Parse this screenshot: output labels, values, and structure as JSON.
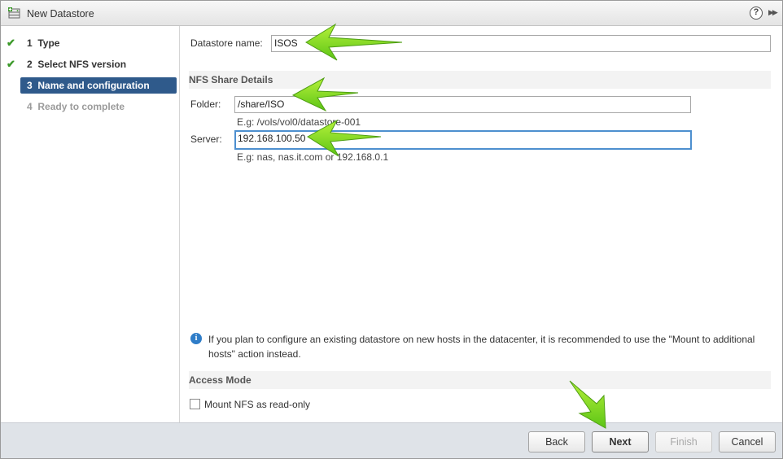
{
  "window": {
    "title": "New Datastore",
    "icon": "datastore-icon"
  },
  "steps": [
    {
      "number": "1",
      "label": "Type",
      "state": "done"
    },
    {
      "number": "2",
      "label": "Select NFS version",
      "state": "done"
    },
    {
      "number": "3",
      "label": "Name and configuration",
      "state": "current"
    },
    {
      "number": "4",
      "label": "Ready to complete",
      "state": "pending"
    }
  ],
  "form": {
    "datastore_name_label": "Datastore name:",
    "datastore_name_value": "ISOS",
    "nfs_section_title": "NFS Share Details",
    "folder_label": "Folder:",
    "folder_value": "/share/ISO",
    "folder_hint": "E.g: /vols/vol0/datastore-001",
    "server_label": "Server:",
    "server_value": "192.168.100.50",
    "server_hint": "E.g: nas, nas.it.com or 192.168.0.1",
    "info_text": "If you plan to configure an existing datastore on new hosts in the datacenter, it is recommended to use the \"Mount to additional hosts\" action instead.",
    "access_section_title": "Access Mode",
    "readonly_label": "Mount NFS as read-only",
    "readonly_checked": false
  },
  "footer": {
    "back_label": "Back",
    "next_label": "Next",
    "finish_label": "Finish",
    "cancel_label": "Cancel"
  },
  "colors": {
    "current_step": "#2f5a8b",
    "check": "#3c9a2a",
    "focus_border": "#4d8fcf",
    "annotation_arrow": "#7ed321"
  }
}
